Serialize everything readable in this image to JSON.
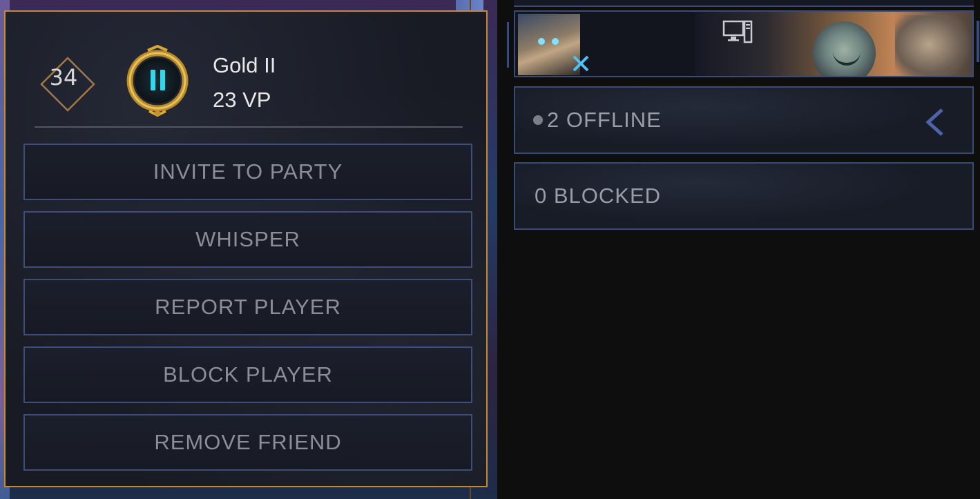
{
  "player_popup": {
    "level": "34",
    "rank_name": "Gold II",
    "rank_points": "23 VP",
    "rank_color": "#d9a934",
    "actions": [
      {
        "label": "INVITE TO PARTY"
      },
      {
        "label": "WHISPER"
      },
      {
        "label": "REPORT PLAYER"
      },
      {
        "label": "BLOCK PLAYER"
      },
      {
        "label": "REMOVE FRIEND"
      }
    ]
  },
  "friends_list": {
    "offline_label": "2 OFFLINE",
    "blocked_label": "0 BLOCKED",
    "accent_color": "#3a4a79"
  },
  "icons": {
    "level_badge": "diamond-level-badge-icon",
    "rank": "gold-rank-pause-icon",
    "platform": "pc-platform-icon",
    "role": "duelist-role-icon",
    "expand": "chevron-left-icon"
  }
}
